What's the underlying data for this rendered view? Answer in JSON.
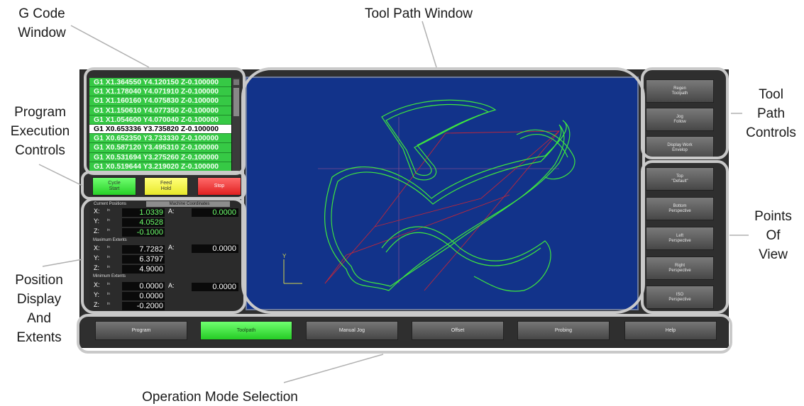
{
  "callouts": {
    "gcode_window": [
      "G Code",
      "Window"
    ],
    "tool_path_window": "Tool Path Window",
    "program_execution_controls": [
      "Program",
      "Execution",
      "Controls"
    ],
    "tool_path_controls": [
      "Tool",
      "Path",
      "Controls"
    ],
    "points_of_view": [
      "Points",
      "Of",
      "View"
    ],
    "position_display_and_extents": [
      "Position",
      "Display",
      "And",
      "Extents"
    ],
    "operation_mode_selection": "Operation Mode Selection"
  },
  "gcode": {
    "lines": [
      "G1 X1.364550 Y4.120150 Z-0.100000",
      "G1 X1.178040 Y4.071910 Z-0.100000",
      "G1 X1.160160 Y4.075830 Z-0.100000",
      "G1 X1.150610 Y4.077350 Z-0.100000",
      "G1 X1.054600 Y4.070040 Z-0.100000",
      "G1 X0.653336 Y3.735820 Z-0.100000",
      "G1 X0.652350 Y3.733330 Z-0.100000",
      "G1 X0.587120 Y3.495310 Z-0.100000",
      "G1 X0.531694 Y3.275260 Z-0.100000",
      "G1 X0.519644 Y3.219020 Z-0.100000"
    ],
    "current_index": 5
  },
  "execution": {
    "cycle_start": [
      "Cycle",
      "Start"
    ],
    "feed_hold": [
      "Feed",
      "Hold"
    ],
    "stop": "Stop"
  },
  "position": {
    "tab_current": "Current Positions",
    "tab_machine": "Machine Coordinates",
    "current": {
      "x": "1.0339",
      "y": "4.0528",
      "z": "-0.1000",
      "a": "0.0000"
    },
    "max_label": "Maximum Extents",
    "max": {
      "x": "7.7282",
      "y": "6.3797",
      "z": "4.9000",
      "a": "0.0000"
    },
    "min_label": "Minimum Extents",
    "min": {
      "x": "0.0000",
      "y": "0.0000",
      "z": "-0.2000",
      "a": "0.0000"
    },
    "axis_x": "X:",
    "axis_y": "Y:",
    "axis_z": "Z:",
    "axis_a": "A:",
    "unit": "in"
  },
  "toolpath_controls": [
    [
      "Regen",
      "Toolpath"
    ],
    [
      "Jog",
      "Follow"
    ],
    [
      "Display Work",
      "Envelop"
    ]
  ],
  "views": [
    [
      "Top",
      "\"Default\""
    ],
    [
      "Bottom",
      "Perspective"
    ],
    [
      "Left",
      "Perspective"
    ],
    [
      "Right",
      "Perspective"
    ],
    [
      "ISO",
      "Perspective"
    ]
  ],
  "modes": [
    "Program",
    "Toolpath",
    "Manual Jog",
    "Offset",
    "Probing",
    "Help"
  ],
  "active_mode": "Toolpath",
  "colors": {
    "gcode_bg": "#36c945",
    "toolpath_bg": "#12338a",
    "path_green": "#3ee83e",
    "path_red": "#c0273a",
    "active_green": "#25cc25"
  }
}
